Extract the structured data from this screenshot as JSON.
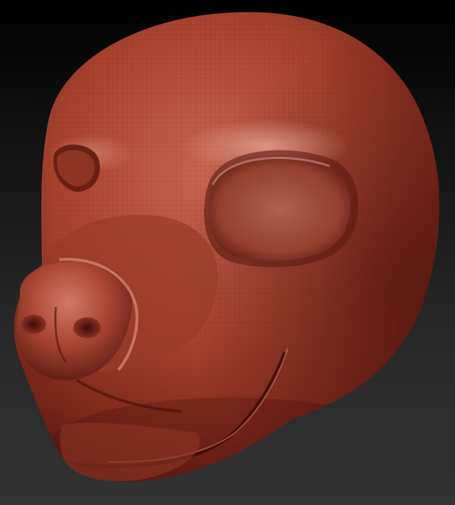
{
  "scene": {
    "subject": "sculpted-animal-head-mask",
    "material_color": "#a8432f",
    "material_highlight": "#d98a78",
    "material_shadow": "#4a130c",
    "wireframe_color": "#5a1a10",
    "background_top": "#000000",
    "background_bottom": "#333333"
  }
}
